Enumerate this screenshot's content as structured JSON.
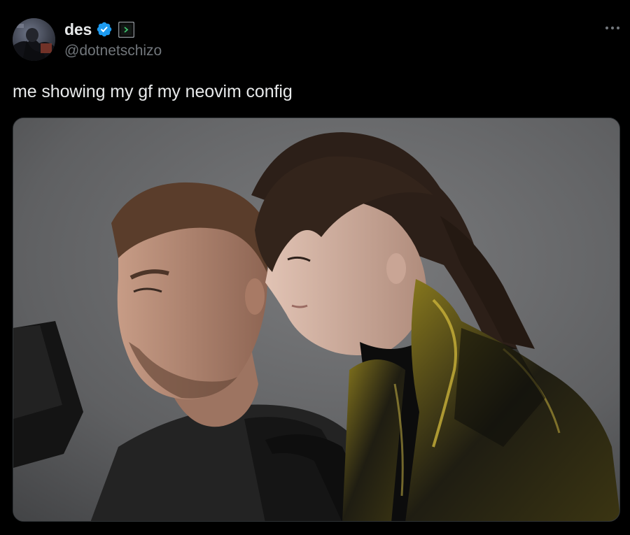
{
  "tweet": {
    "author": {
      "display_name": "des",
      "handle": "@dotnetschizo",
      "verified": true,
      "avatar_icon": "avatar-photo",
      "affiliate_badge_icon": "terminal-badge-icon"
    },
    "more_icon": "more-horizontal-icon",
    "text": "me showing my gf my neovim config",
    "media": {
      "type": "photo",
      "icon": "photo-two-people-at-monitor"
    }
  },
  "colors": {
    "background": "#000000",
    "primary_text": "#e7e9ea",
    "secondary_text": "#71767b",
    "verified_blue": "#1d9bf0",
    "border": "#2f3336"
  }
}
